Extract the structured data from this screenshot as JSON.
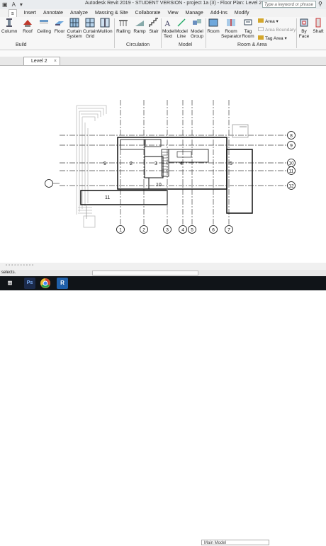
{
  "app": {
    "title": "Autodesk Revit 2019 - STUDENT VERSION - project 1a (3) - Floor Plan: Level 2"
  },
  "search": {
    "placeholder": "Type a keyword or phrase"
  },
  "menu": {
    "tabs": [
      "s",
      "Insert",
      "Annotate",
      "Analyze",
      "Massing & Site",
      "Collaborate",
      "View",
      "Manage",
      "Add-Ins",
      "Modify"
    ]
  },
  "ribbon": {
    "build": {
      "label": "Build",
      "buttons": [
        "Column",
        "Roof",
        "Ceiling",
        "Floor",
        "Curtain System",
        "Curtain Grid",
        "Mullion"
      ]
    },
    "circulation": {
      "label": "Circulation",
      "buttons": [
        "Railing",
        "Ramp",
        "Stair"
      ]
    },
    "model": {
      "label": "Model",
      "buttons": [
        "Model Text",
        "Model Line",
        "Model Group"
      ]
    },
    "room_area": {
      "label": "Room & Area",
      "buttons": [
        "Room",
        "Room Separator",
        "Tag Room"
      ],
      "small": [
        "Area",
        "Area Boundary",
        "Tag Area"
      ]
    },
    "opening": {
      "buttons": [
        "By Face",
        "Shaft"
      ]
    }
  },
  "view_tab": {
    "label": "Level 2"
  },
  "plan": {
    "grid_numbers": [
      "1",
      "2",
      "3",
      "4",
      "5",
      "6",
      "7"
    ],
    "grid_letters": [
      "8",
      "9",
      "10",
      "11",
      "12"
    ],
    "rooms": [
      "9",
      "2",
      "3",
      "4",
      "5",
      "10",
      "11"
    ]
  },
  "status": {
    "text": "selects.",
    "model": "Main Model"
  },
  "taskbar": {
    "items": [
      "Ps",
      "R"
    ]
  },
  "colors": {
    "taskbar": "#101418",
    "photoshop": "#1b2a4a",
    "revit": "#1f5fa8",
    "chrome": "#e8b931"
  }
}
